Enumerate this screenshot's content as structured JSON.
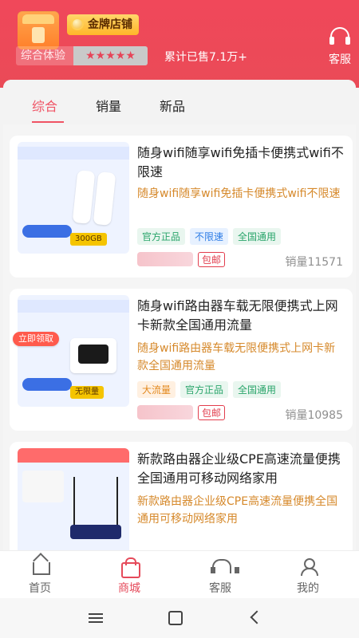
{
  "header": {
    "store_badge": "金牌店铺",
    "rating_label": "综合体验",
    "stars": "★★★★★",
    "sold_text": "累计已售7.1万+",
    "service_label": "客服"
  },
  "tabs": [
    {
      "label": "综合"
    },
    {
      "label": "销量"
    },
    {
      "label": "新品"
    }
  ],
  "products": [
    {
      "title": "随身wifi随享wifi免插卡便携式wifi不限速",
      "subtitle": "随身wifi随享wifi免插卡便携式wifi不限速",
      "tags": [
        "官方正品",
        "不限速",
        "全国通用"
      ],
      "postage": "包邮",
      "sales": "销量11571"
    },
    {
      "title": "随身wifi路由器车载无限便携式上网卡新款全国通用流量",
      "subtitle": "随身wifi路由器车载无限便携式上网卡新款全国通用流量",
      "tags": [
        "大流量",
        "官方正品",
        "全国通用"
      ],
      "postage": "包邮",
      "sales": "销量10985",
      "claim": "立即领取"
    },
    {
      "title": "新款路由器企业级CPE高速流量便携全国通用可移动网络家用",
      "subtitle": "新款路由器企业级CPE高速流量便携全国通用可移动网络家用"
    }
  ],
  "bottom_nav": [
    {
      "label": "首页",
      "icon": "home-icon"
    },
    {
      "label": "商城",
      "icon": "shop-icon"
    },
    {
      "label": "客服",
      "icon": "headset-icon"
    },
    {
      "label": "我的",
      "icon": "user-icon"
    }
  ],
  "colors": {
    "header_bg": "#f0485a",
    "accent": "#f05364",
    "tag_green": "#2aa56b",
    "tag_blue": "#2e7de6",
    "tag_orange": "#e38a20"
  }
}
